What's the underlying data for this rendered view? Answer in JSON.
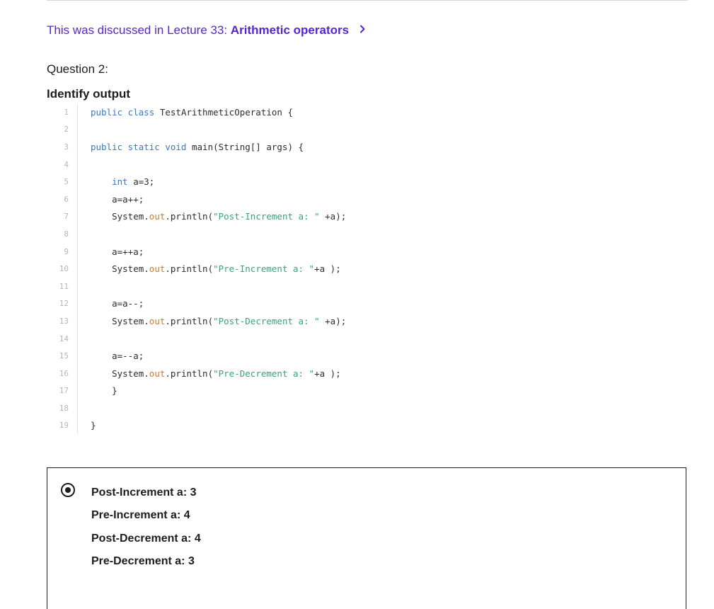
{
  "lecture_link": {
    "prefix": "This was discussed in Lecture 33: ",
    "title": "Arithmetic operators",
    "chevron_icon": "chevron-right-icon",
    "color": "#5624d0"
  },
  "question": {
    "number_label": "Question 2:",
    "title": "Identify output"
  },
  "code": {
    "lines": [
      {
        "num": "1",
        "indent": "",
        "segments": [
          {
            "t": "public class ",
            "c": "kw"
          },
          {
            "t": "TestArithmeticOperation {",
            "c": ""
          }
        ]
      },
      {
        "num": "2",
        "indent": "",
        "segments": []
      },
      {
        "num": "3",
        "indent": "",
        "segments": [
          {
            "t": "public static void ",
            "c": "kw"
          },
          {
            "t": "main(String[] args) {",
            "c": ""
          }
        ]
      },
      {
        "num": "4",
        "indent": "",
        "segments": []
      },
      {
        "num": "5",
        "indent": "    ",
        "segments": [
          {
            "t": "int ",
            "c": "kw"
          },
          {
            "t": "a=3;",
            "c": ""
          }
        ]
      },
      {
        "num": "6",
        "indent": "    ",
        "segments": [
          {
            "t": "a=a++;",
            "c": ""
          }
        ]
      },
      {
        "num": "7",
        "indent": "    ",
        "segments": [
          {
            "t": "System.",
            "c": ""
          },
          {
            "t": "out",
            "c": "fld"
          },
          {
            "t": ".println(",
            "c": ""
          },
          {
            "t": "\"Post-Increment a: \"",
            "c": "str"
          },
          {
            "t": " +a);",
            "c": ""
          }
        ]
      },
      {
        "num": "8",
        "indent": "",
        "segments": []
      },
      {
        "num": "9",
        "indent": "    ",
        "segments": [
          {
            "t": "a=++a;",
            "c": ""
          }
        ]
      },
      {
        "num": "10",
        "indent": "    ",
        "segments": [
          {
            "t": "System.",
            "c": ""
          },
          {
            "t": "out",
            "c": "fld"
          },
          {
            "t": ".println(",
            "c": ""
          },
          {
            "t": "\"Pre-Increment a: \"",
            "c": "str"
          },
          {
            "t": "+a );",
            "c": ""
          }
        ]
      },
      {
        "num": "11",
        "indent": "",
        "segments": []
      },
      {
        "num": "12",
        "indent": "    ",
        "segments": [
          {
            "t": "a=a--;",
            "c": ""
          }
        ]
      },
      {
        "num": "13",
        "indent": "    ",
        "segments": [
          {
            "t": "System.",
            "c": ""
          },
          {
            "t": "out",
            "c": "fld"
          },
          {
            "t": ".println(",
            "c": ""
          },
          {
            "t": "\"Post-Decrement a: \"",
            "c": "str"
          },
          {
            "t": " +a);",
            "c": ""
          }
        ]
      },
      {
        "num": "14",
        "indent": "",
        "segments": []
      },
      {
        "num": "15",
        "indent": "    ",
        "segments": [
          {
            "t": "a=--a;",
            "c": ""
          }
        ]
      },
      {
        "num": "16",
        "indent": "    ",
        "segments": [
          {
            "t": "System.",
            "c": ""
          },
          {
            "t": "out",
            "c": "fld"
          },
          {
            "t": ".println(",
            "c": ""
          },
          {
            "t": "\"Pre-Decrement a: \"",
            "c": "str"
          },
          {
            "t": "+a );",
            "c": ""
          }
        ]
      },
      {
        "num": "17",
        "indent": "    ",
        "segments": [
          {
            "t": "}",
            "c": ""
          }
        ]
      },
      {
        "num": "18",
        "indent": "",
        "segments": []
      },
      {
        "num": "19",
        "indent": "",
        "segments": [
          {
            "t": "}",
            "c": ""
          }
        ]
      }
    ],
    "colors": {
      "keyword": "#3a7abf",
      "string": "#32a57c",
      "field": "#d17a2c"
    }
  },
  "answer": {
    "selected": true,
    "radio_icon": "radio-selected-icon",
    "lines": [
      "Post-Increment a: 3",
      "Pre-Increment a: 4",
      "Post-Decrement a: 4",
      "Pre-Decrement a: 3"
    ]
  }
}
